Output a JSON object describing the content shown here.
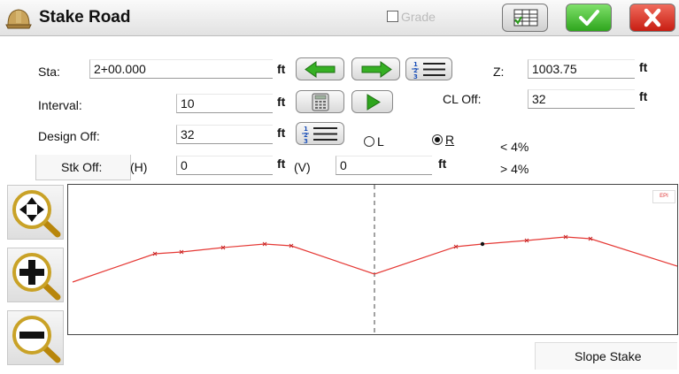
{
  "header": {
    "title": "Stake Road",
    "grade_label": "Grade"
  },
  "form": {
    "sta": {
      "label": "Sta:",
      "value": "2+00.000",
      "unit": "ft"
    },
    "interval": {
      "label": "Interval:",
      "value": "10",
      "unit": "ft"
    },
    "design_off": {
      "label": "Design Off:",
      "value": "32",
      "unit": "ft"
    },
    "z": {
      "label": "Z:",
      "value": "1003.75",
      "unit": "ft"
    },
    "cl_off": {
      "label": "CL Off:",
      "value": "32",
      "unit": "ft"
    },
    "side": {
      "left_label": "L",
      "right_label": "R",
      "selected": "R"
    },
    "grade_less": "< 4%",
    "grade_more": "> 4%",
    "stk_off": {
      "button_label": "Stk Off:",
      "h_label": "(H)",
      "h_value": "0",
      "h_unit": "ft",
      "v_label": "(V)",
      "v_value": "0",
      "v_unit": "ft"
    }
  },
  "plot": {
    "ep_label": "EPI",
    "line_color": "#e53935",
    "centerline_style": "dashed"
  },
  "footer": {
    "slope_stake_label": "Slope Stake"
  },
  "icons": [
    "hard-hat-icon",
    "table-icon",
    "checkmark-icon",
    "close-icon",
    "arrow-left-icon",
    "arrow-right-icon",
    "list-icon",
    "calculator-icon",
    "play-icon",
    "zoom-extents-icon",
    "zoom-in-icon",
    "zoom-out-icon"
  ]
}
